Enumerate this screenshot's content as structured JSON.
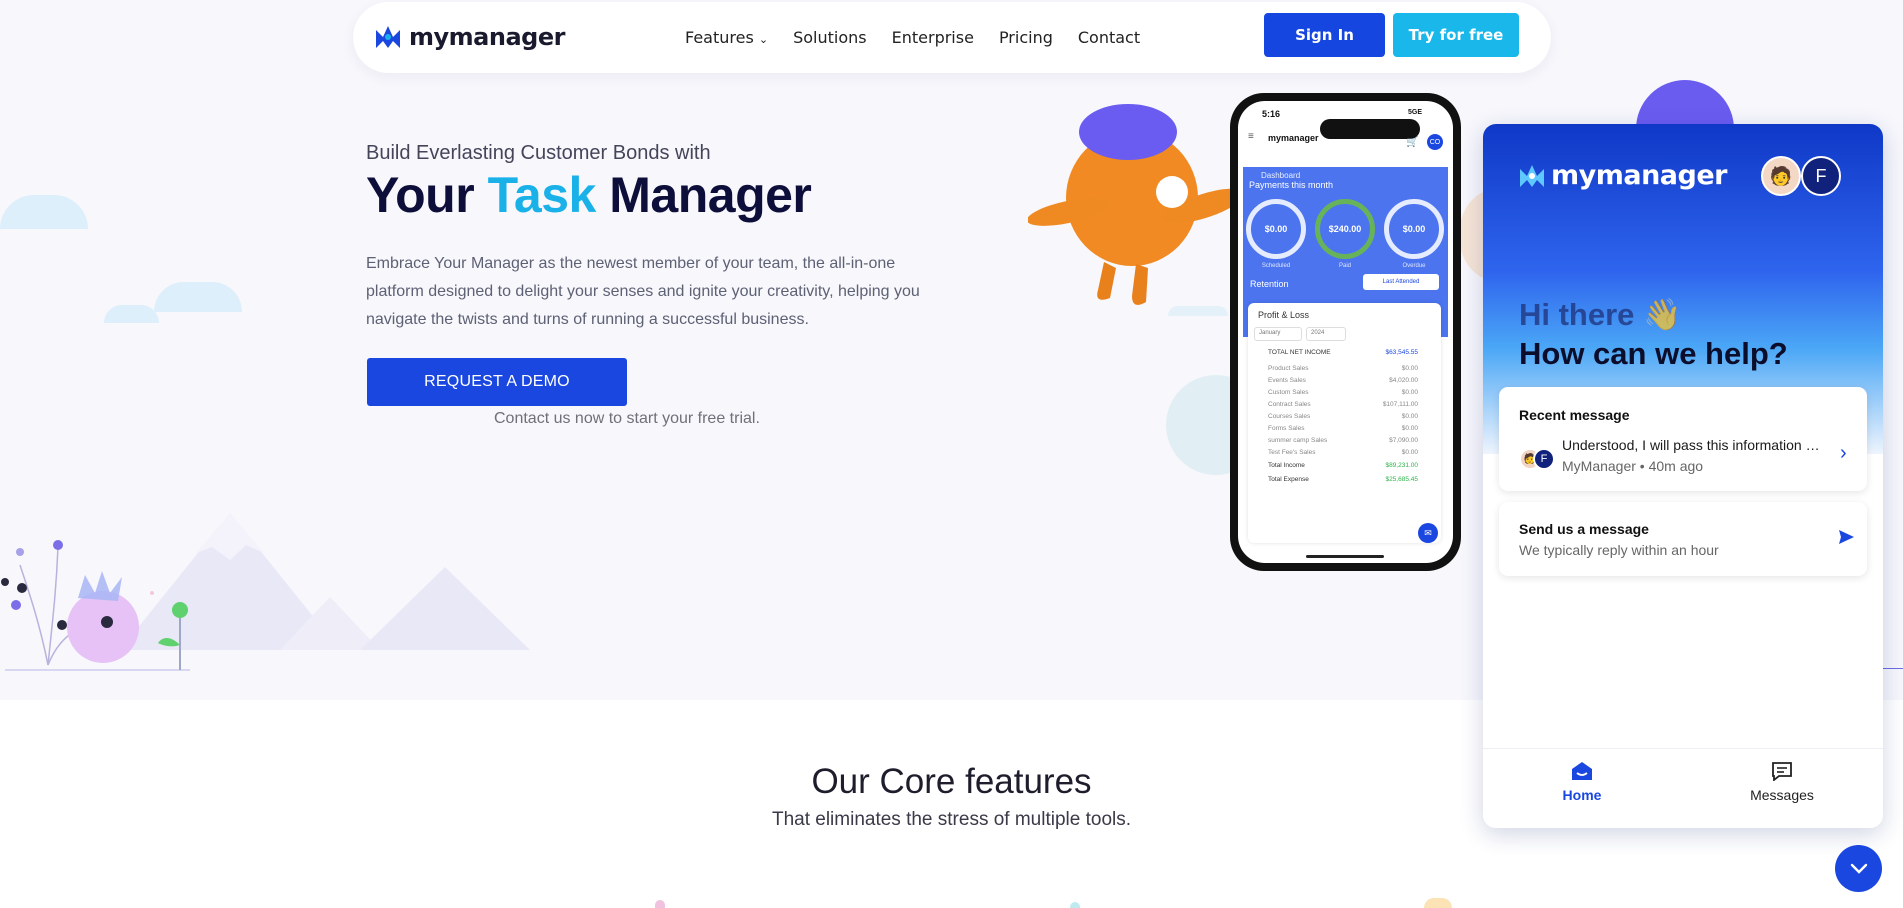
{
  "nav": {
    "logo_text": "mymanager",
    "links": [
      "Features",
      "Solutions",
      "Enterprise",
      "Pricing",
      "Contact"
    ],
    "signin_label": "Sign In",
    "try_label": "Try for free"
  },
  "hero": {
    "eyebrow": "Build Everlasting Customer Bonds with",
    "headline_pre": "Your",
    "headline_accent": "Task",
    "headline_post": "Manager",
    "description": "Embrace Your Manager as the newest member of your team, the all-in-one platform designed to delight your senses and ignite your creativity, helping you navigate the twists and turns of running a successful business.",
    "cta_label": "REQUEST A DEMO",
    "cta_sub": "Contact us now to start your free trial."
  },
  "phone": {
    "time": "5:16",
    "signal": "5GE",
    "logo": "mymanager",
    "avatar_initials": "CO",
    "dashboard_label": "Dashboard",
    "payments_title": "Payments this month",
    "rings": [
      {
        "value": "$0.00",
        "label": "Scheduled"
      },
      {
        "value": "$240.00",
        "label": "Paid"
      },
      {
        "value": "$0.00",
        "label": "Overdue"
      }
    ],
    "retention_label": "Retention",
    "retention_select": "Last Attended",
    "pl_title": "Profit & Loss",
    "month_select": "January",
    "year_select": "2024",
    "rows": [
      {
        "name": "TOTAL NET INCOME",
        "value": "$63,545.55"
      },
      {
        "name": "Product Sales",
        "value": "$0.00"
      },
      {
        "name": "Events Sales",
        "value": "$4,020.00"
      },
      {
        "name": "Custom Sales",
        "value": "$0.00"
      },
      {
        "name": "Contract Sales",
        "value": "$107,111.00"
      },
      {
        "name": "Courses Sales",
        "value": "$0.00"
      },
      {
        "name": "Forms Sales",
        "value": "$0.00"
      },
      {
        "name": "summer camp Sales",
        "value": "$7,090.00"
      },
      {
        "name": "Test Fee's Sales",
        "value": "$0.00"
      },
      {
        "name": "Total Income",
        "value": "$89,231.00"
      },
      {
        "name": "Total Expense",
        "value": "$25,685.45"
      }
    ]
  },
  "chat": {
    "logo_text": "mymanager",
    "agent_initial": "F",
    "greeting_1": "Hi there 👋",
    "greeting_2": "How can we help?",
    "recent_title": "Recent message",
    "recent_text": "Understood, I will pass this information along to the team.",
    "recent_meta": "MyManager • 40m ago",
    "send_title": "Send us a message",
    "send_sub": "We typically reply within an hour",
    "tab_home": "Home",
    "tab_messages": "Messages"
  },
  "features": {
    "title": "Our Core features",
    "subtitle": "That eliminates the stress of multiple tools."
  },
  "colors": {
    "brand_blue": "#1a47e0",
    "accent_cyan": "#1ab1e8",
    "navy": "#0d0f3a"
  }
}
